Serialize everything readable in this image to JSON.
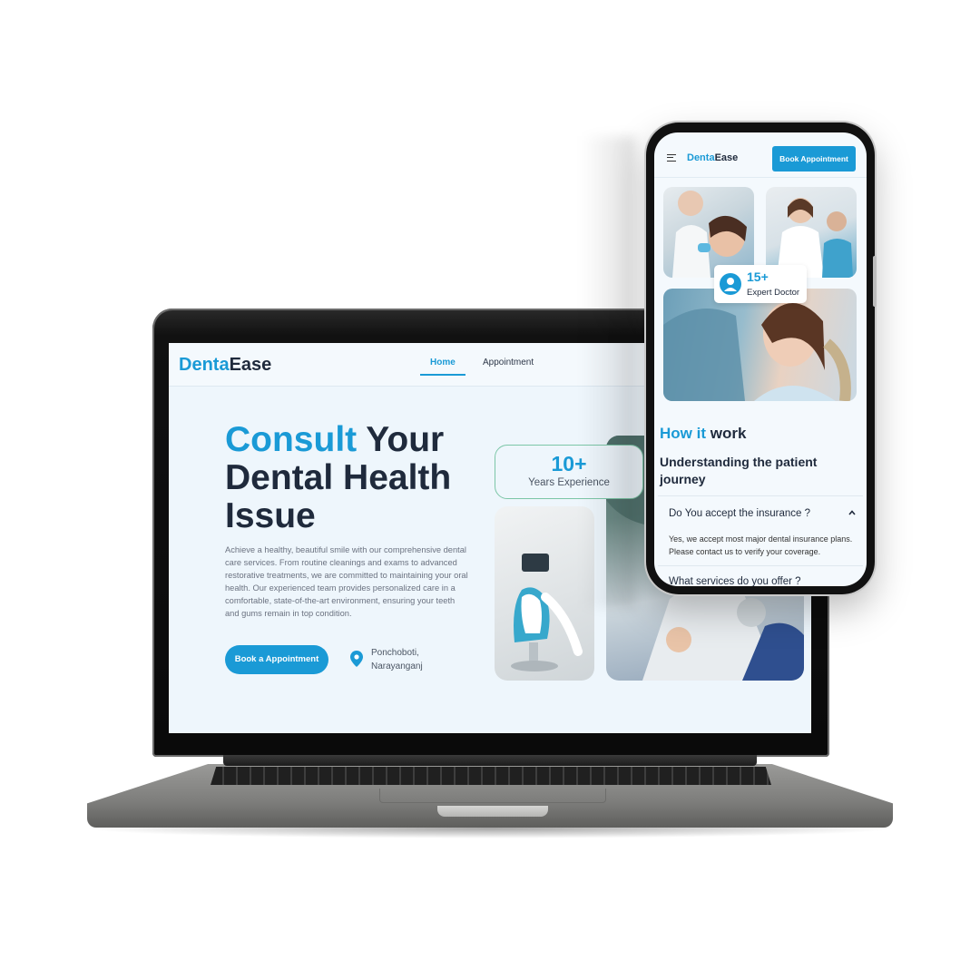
{
  "colors": {
    "accent": "#1a9ad6",
    "dark": "#1f2a3c",
    "background": "#eef6fc"
  },
  "desktop": {
    "logo": {
      "part1": "Denta",
      "part2": "Ease"
    },
    "nav": {
      "home": "Home",
      "appointment": "Appointment"
    },
    "hero": {
      "title_accent": "Consult",
      "title_rest": " Your Dental Health Issue",
      "description": "Achieve a healthy, beautiful smile with our comprehensive dental care services. From routine cleanings and exams to advanced restorative treatments, we are committed to maintaining your oral health. Our experienced team provides personalized care in a comfortable, state-of-the-art environment, ensuring your teeth and gums remain in top condition.",
      "cta": "Book a Appointment",
      "location_line1": "Ponchoboti,",
      "location_line2": "Narayanganj"
    },
    "experience": {
      "number": "10+",
      "label": "Years Experience"
    },
    "icons": {
      "location": "map-pin-icon"
    }
  },
  "mobile": {
    "logo": {
      "part1": "Denta",
      "part2": "Ease"
    },
    "book_button": "Book Appointment",
    "badge": {
      "number": "15+",
      "label": "Expert Doctor"
    },
    "how": {
      "accent": "How it",
      "rest": " work"
    },
    "subtitle": "Understanding the patient journey",
    "faq": [
      {
        "question": "Do You accept the insurance ?",
        "answer": "Yes, we accept most major dental insurance plans. Please contact us to verify your coverage."
      },
      {
        "question": "What services do you offer ?"
      }
    ],
    "icons": {
      "menu": "hamburger-menu-icon",
      "badge": "doctor-icon",
      "chevron": "chevron-up-icon"
    }
  }
}
